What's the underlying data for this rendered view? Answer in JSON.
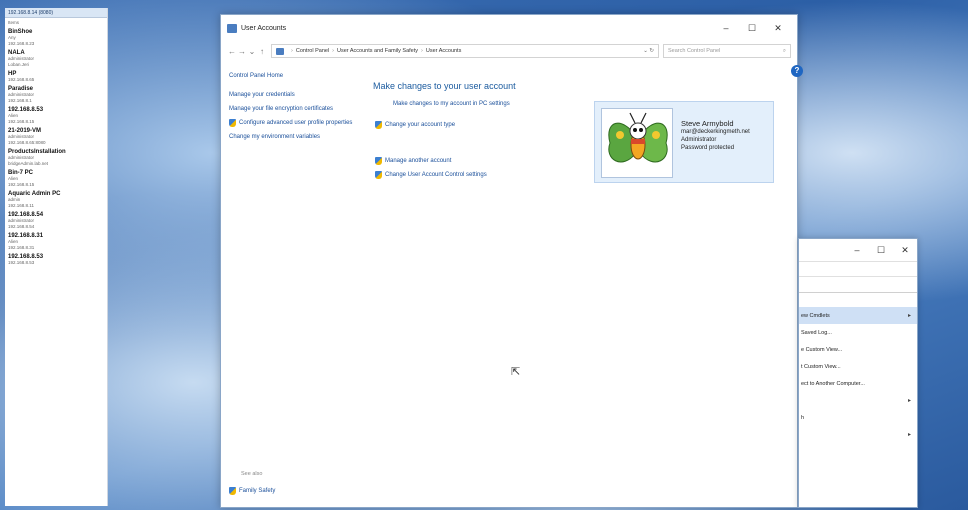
{
  "side_panel": {
    "header": "192.168.8.14 (8080)",
    "subheader": "Items",
    "entries": [
      {
        "name": "BinShoe",
        "lines": [
          "Any",
          "192.168.8.23"
        ]
      },
      {
        "name": "NALA",
        "lines": [
          "administrator",
          "Loban.Jeri"
        ]
      },
      {
        "name": "HP",
        "lines": [
          "",
          "192.168.8.65"
        ]
      },
      {
        "name": "Paradise",
        "lines": [
          "administrator",
          "192.168.8.1"
        ]
      },
      {
        "name": "192.168.8.53",
        "lines": [
          "Alien",
          "192.168.8.15"
        ]
      },
      {
        "name": "21-2019-VM",
        "lines": [
          "administrator",
          "192.168.8.65:8080"
        ]
      },
      {
        "name": "ProductsInstallation",
        "lines": [
          "administrator",
          "bridgeAdmin.lab.net"
        ]
      },
      {
        "name": "Bin-7 PC",
        "lines": [
          "Alien",
          "192.168.8.15"
        ]
      },
      {
        "name": "Aquaric Admin PC",
        "lines": [
          "admin",
          "192.168.8.11"
        ]
      },
      {
        "name": "192.168.8.54",
        "lines": [
          "administrator",
          "192.168.8.54"
        ]
      },
      {
        "name": "192.168.8.31",
        "lines": [
          "Alien",
          "192.168.8.31"
        ]
      },
      {
        "name": "192.168.8.53",
        "lines": [
          "",
          "192.168.8.53"
        ]
      }
    ]
  },
  "main_window": {
    "title": "User Accounts",
    "controls": {
      "minimize": "–",
      "maximize": "☐",
      "close": "✕"
    },
    "breadcrumb": [
      "Control Panel",
      "User Accounts and Family Safety",
      "User Accounts"
    ],
    "search_placeholder": "Search Control Panel",
    "help": "?",
    "left_nav": {
      "home": "Control Panel Home",
      "links": [
        {
          "label": "Manage your credentials",
          "shield": false
        },
        {
          "label": "Manage your file encryption certificates",
          "shield": false
        },
        {
          "label": "Configure advanced user profile properties",
          "shield": true
        },
        {
          "label": "Change my environment variables",
          "shield": false
        }
      ]
    },
    "see_also": "See also",
    "family_safety": "Family Safety",
    "content": {
      "heading": "Make changes to your user account",
      "pc_settings_link": "Make changes to my account in PC settings",
      "actions_top": [
        "Change your account type"
      ],
      "actions_bottom": [
        "Manage another account",
        "Change User Account Control settings"
      ]
    },
    "user_card": {
      "name": "Steve Armybold",
      "email": "mar@deckerkingmeth.net",
      "role": "Administrator",
      "status": "Password protected"
    }
  },
  "second_window": {
    "controls": {
      "minimize": "–",
      "maximize": "☐",
      "close": "✕"
    },
    "items": [
      {
        "label": "ew Cmdlets",
        "arrow": "▸",
        "selected": true
      },
      {
        "label": "Saved Log...",
        "arrow": "",
        "selected": false
      },
      {
        "label": "e Custom View...",
        "arrow": "",
        "selected": false
      },
      {
        "label": "t Custom View...",
        "arrow": "",
        "selected": false
      },
      {
        "label": "ect to Another Computer...",
        "arrow": "",
        "selected": false
      },
      {
        "label": "",
        "arrow": "▸",
        "selected": false
      },
      {
        "label": "h",
        "arrow": "",
        "selected": false
      },
      {
        "label": "",
        "arrow": "▸",
        "selected": false
      }
    ]
  }
}
